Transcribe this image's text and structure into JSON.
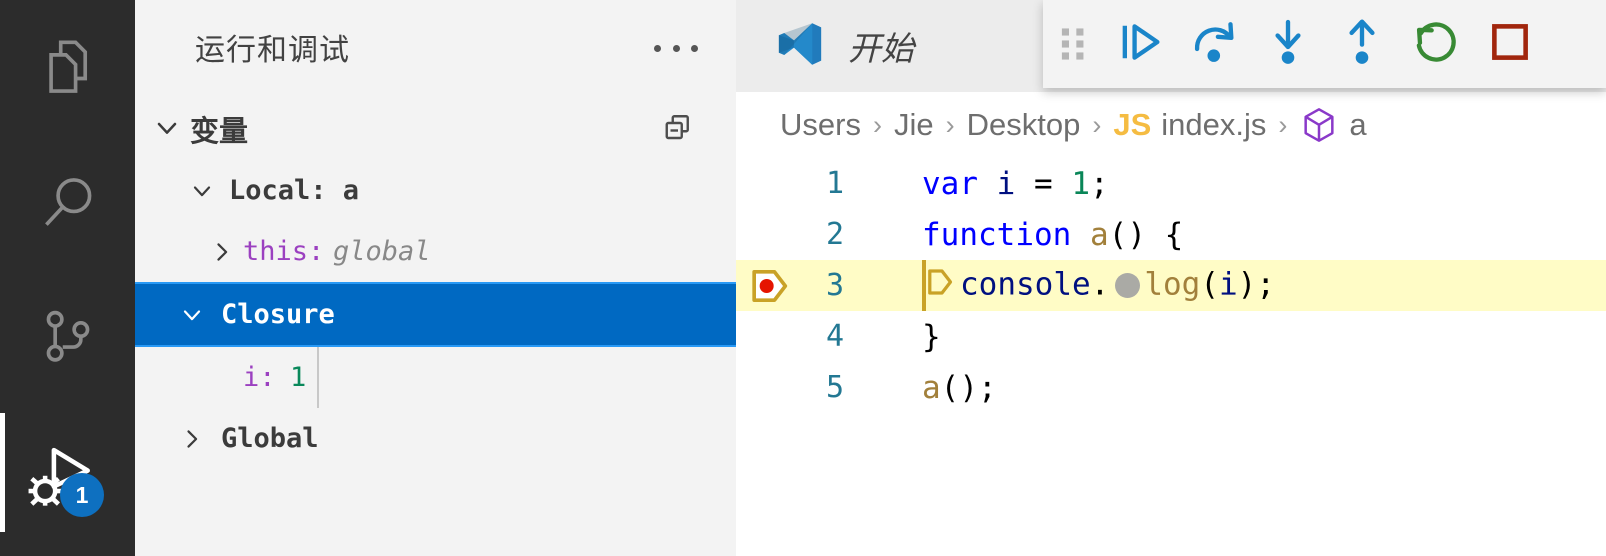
{
  "theme": {
    "activity_bar_bg": "#2c2c2c",
    "sidebar_bg": "#f3f3f3",
    "selection_blue": "#0069c2",
    "badge_blue": "#0e70c0",
    "highlight_yellow": "#fffcc6",
    "breakpoint_red": "#e51400",
    "stop_red": "#a1260d",
    "restart_green": "#388a34",
    "debug_blue": "#1a85c9"
  },
  "activity_bar": {
    "items": [
      {
        "icon": "explorer-files-icon",
        "name": "explorer",
        "active": false
      },
      {
        "icon": "search-magnifier-icon",
        "name": "search",
        "active": false
      },
      {
        "icon": "source-control-branch-icon",
        "name": "source-control",
        "active": false
      },
      {
        "icon": "run-and-debug-icon",
        "name": "run-and-debug",
        "active": true,
        "badge": "1"
      }
    ]
  },
  "sidebar": {
    "title": "运行和调试",
    "more_actions_icon": "ellipsis-icon",
    "section": {
      "label": "变量",
      "expanded": true,
      "collapse_all_icon": "collapse-all-icon"
    },
    "tree": [
      {
        "label": "Local: a",
        "twisty": "chevron-down-icon",
        "style": "scope",
        "indent": 1,
        "selected": false
      },
      {
        "key": "this:",
        "value": "global",
        "twisty": "chevron-right-icon",
        "style": "variable",
        "indent": 2,
        "selected": false
      },
      {
        "label": "Closure",
        "twisty": "chevron-down-icon",
        "style": "scope",
        "indent": 1,
        "selected": true
      },
      {
        "key": "i:",
        "value": "1",
        "twisty": "",
        "style": "variable-number",
        "indent": 2,
        "selected": false
      },
      {
        "label": "Global",
        "twisty": "chevron-right-icon",
        "style": "scope",
        "indent": 1,
        "selected": false
      }
    ]
  },
  "editor": {
    "tab": {
      "label": "开始",
      "icon": "vscode-logo-icon",
      "active": true
    },
    "breadcrumbs": [
      {
        "label": "Users",
        "icon": ""
      },
      {
        "label": "Jie",
        "icon": ""
      },
      {
        "label": "Desktop",
        "icon": ""
      },
      {
        "label": "index.js",
        "icon": "js-file-icon"
      },
      {
        "label": "a",
        "icon": "symbol-function-icon"
      }
    ],
    "breadcrumb_separator": "›",
    "lines": [
      {
        "number": "1",
        "breakpoint": false,
        "current": false,
        "tokens": [
          {
            "t": "var",
            "c": "kw"
          },
          {
            "t": " ",
            "c": "plain"
          },
          {
            "t": "i",
            "c": "var"
          },
          {
            "t": " = ",
            "c": "plain"
          },
          {
            "t": "1",
            "c": "num"
          },
          {
            "t": ";",
            "c": "plain"
          }
        ]
      },
      {
        "number": "2",
        "breakpoint": false,
        "current": false,
        "tokens": [
          {
            "t": "function",
            "c": "kw"
          },
          {
            "t": " ",
            "c": "plain"
          },
          {
            "t": "a",
            "c": "fn"
          },
          {
            "t": "() {",
            "c": "plain"
          }
        ]
      },
      {
        "number": "3",
        "breakpoint": true,
        "current": true,
        "marker_icon": "debug-stackframe-icon",
        "suggest_dot": true,
        "tokens": [
          {
            "t": "console",
            "c": "var"
          },
          {
            "t": ".",
            "c": "plain"
          },
          {
            "t": "log",
            "c": "fn"
          },
          {
            "t": "(",
            "c": "plain"
          },
          {
            "t": "i",
            "c": "var"
          },
          {
            "t": ");",
            "c": "plain"
          }
        ]
      },
      {
        "number": "4",
        "breakpoint": false,
        "current": false,
        "tokens": [
          {
            "t": "}",
            "c": "plain"
          }
        ]
      },
      {
        "number": "5",
        "breakpoint": false,
        "current": false,
        "tokens": [
          {
            "t": "a",
            "c": "fn"
          },
          {
            "t": "();",
            "c": "plain"
          }
        ]
      }
    ]
  },
  "debug_toolbar": {
    "handle_icon": "drag-handle-icon",
    "buttons": [
      {
        "name": "continue",
        "icon": "debug-continue-icon",
        "color": "#1a85c9"
      },
      {
        "name": "step-over",
        "icon": "debug-step-over-icon",
        "color": "#1a85c9"
      },
      {
        "name": "step-into",
        "icon": "debug-step-into-icon",
        "color": "#1a85c9"
      },
      {
        "name": "step-out",
        "icon": "debug-step-out-icon",
        "color": "#1a85c9"
      },
      {
        "name": "restart",
        "icon": "debug-restart-icon",
        "color": "#388a34"
      },
      {
        "name": "stop",
        "icon": "debug-stop-icon",
        "color": "#a1260d"
      }
    ]
  }
}
